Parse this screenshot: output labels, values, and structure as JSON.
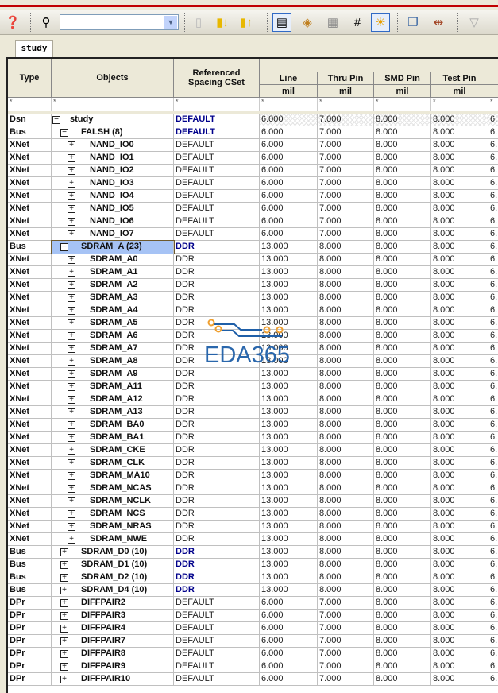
{
  "toolbar": {
    "combo_value": "",
    "buttons": [
      "help-icon",
      "find-icon",
      "bookmark-icon",
      "bookmark-next-icon",
      "bookmark-prev-icon",
      "spacing-icon",
      "net-class-icon",
      "table-icon",
      "same-net-icon",
      "highlight-icon",
      "windows-icon",
      "diff-pair-icon",
      "filter-icon"
    ]
  },
  "tab": {
    "label": "study"
  },
  "columns": {
    "type": "Type",
    "objects": "Objects",
    "cset": "Referenced Spacing CSet",
    "line": "Line",
    "thru": "Thru Pin",
    "smd": "SMD Pin",
    "test": "Test Pin",
    "unit": "mil",
    "filter": "*"
  },
  "rows": [
    {
      "type": "Dsn",
      "obj": "study",
      "exp": "-",
      "lvl": 0,
      "cset": "DEFAULT",
      "v": [
        "6.000",
        "7.000",
        "8.000",
        "8.000",
        "6."
      ]
    },
    {
      "type": "Bus",
      "obj": "FALSH (8)",
      "exp": "-",
      "lvl": 1,
      "cset": "DEFAULT",
      "v": [
        "6.000",
        "7.000",
        "8.000",
        "8.000",
        "6."
      ]
    },
    {
      "type": "XNet",
      "obj": "NAND_IO0",
      "exp": "+",
      "lvl": 2,
      "cset": "DEFAULT",
      "v": [
        "6.000",
        "7.000",
        "8.000",
        "8.000",
        "6."
      ]
    },
    {
      "type": "XNet",
      "obj": "NAND_IO1",
      "exp": "+",
      "lvl": 2,
      "cset": "DEFAULT",
      "v": [
        "6.000",
        "7.000",
        "8.000",
        "8.000",
        "6."
      ]
    },
    {
      "type": "XNet",
      "obj": "NAND_IO2",
      "exp": "+",
      "lvl": 2,
      "cset": "DEFAULT",
      "v": [
        "6.000",
        "7.000",
        "8.000",
        "8.000",
        "6."
      ]
    },
    {
      "type": "XNet",
      "obj": "NAND_IO3",
      "exp": "+",
      "lvl": 2,
      "cset": "DEFAULT",
      "v": [
        "6.000",
        "7.000",
        "8.000",
        "8.000",
        "6."
      ]
    },
    {
      "type": "XNet",
      "obj": "NAND_IO4",
      "exp": "+",
      "lvl": 2,
      "cset": "DEFAULT",
      "v": [
        "6.000",
        "7.000",
        "8.000",
        "8.000",
        "6."
      ]
    },
    {
      "type": "XNet",
      "obj": "NAND_IO5",
      "exp": "+",
      "lvl": 2,
      "cset": "DEFAULT",
      "v": [
        "6.000",
        "7.000",
        "8.000",
        "8.000",
        "6."
      ]
    },
    {
      "type": "XNet",
      "obj": "NAND_IO6",
      "exp": "+",
      "lvl": 2,
      "cset": "DEFAULT",
      "v": [
        "6.000",
        "7.000",
        "8.000",
        "8.000",
        "6."
      ]
    },
    {
      "type": "XNet",
      "obj": "NAND_IO7",
      "exp": "+",
      "lvl": 2,
      "cset": "DEFAULT",
      "v": [
        "6.000",
        "7.000",
        "8.000",
        "8.000",
        "6."
      ]
    },
    {
      "type": "Bus",
      "obj": "SDRAM_A (23)",
      "exp": "-",
      "lvl": 1,
      "cset": "DDR",
      "v": [
        "13.000",
        "8.000",
        "8.000",
        "8.000",
        "6."
      ],
      "selected": true
    },
    {
      "type": "XNet",
      "obj": "SDRAM_A0",
      "exp": "+",
      "lvl": 2,
      "cset": "DDR",
      "v": [
        "13.000",
        "8.000",
        "8.000",
        "8.000",
        "6."
      ]
    },
    {
      "type": "XNet",
      "obj": "SDRAM_A1",
      "exp": "+",
      "lvl": 2,
      "cset": "DDR",
      "v": [
        "13.000",
        "8.000",
        "8.000",
        "8.000",
        "6."
      ]
    },
    {
      "type": "XNet",
      "obj": "SDRAM_A2",
      "exp": "+",
      "lvl": 2,
      "cset": "DDR",
      "v": [
        "13.000",
        "8.000",
        "8.000",
        "8.000",
        "6."
      ]
    },
    {
      "type": "XNet",
      "obj": "SDRAM_A3",
      "exp": "+",
      "lvl": 2,
      "cset": "DDR",
      "v": [
        "13.000",
        "8.000",
        "8.000",
        "8.000",
        "6."
      ]
    },
    {
      "type": "XNet",
      "obj": "SDRAM_A4",
      "exp": "+",
      "lvl": 2,
      "cset": "DDR",
      "v": [
        "13.000",
        "8.000",
        "8.000",
        "8.000",
        "6."
      ]
    },
    {
      "type": "XNet",
      "obj": "SDRAM_A5",
      "exp": "+",
      "lvl": 2,
      "cset": "DDR",
      "v": [
        "13.000",
        "8.000",
        "8.000",
        "8.000",
        "6."
      ]
    },
    {
      "type": "XNet",
      "obj": "SDRAM_A6",
      "exp": "+",
      "lvl": 2,
      "cset": "DDR",
      "v": [
        "13.000",
        "8.000",
        "8.000",
        "8.000",
        "6."
      ]
    },
    {
      "type": "XNet",
      "obj": "SDRAM_A7",
      "exp": "+",
      "lvl": 2,
      "cset": "DDR",
      "v": [
        "13.000",
        "8.000",
        "8.000",
        "8.000",
        "6."
      ]
    },
    {
      "type": "XNet",
      "obj": "SDRAM_A8",
      "exp": "+",
      "lvl": 2,
      "cset": "DDR",
      "v": [
        "13.000",
        "8.000",
        "8.000",
        "8.000",
        "6."
      ]
    },
    {
      "type": "XNet",
      "obj": "SDRAM_A9",
      "exp": "+",
      "lvl": 2,
      "cset": "DDR",
      "v": [
        "13.000",
        "8.000",
        "8.000",
        "8.000",
        "6."
      ]
    },
    {
      "type": "XNet",
      "obj": "SDRAM_A11",
      "exp": "+",
      "lvl": 2,
      "cset": "DDR",
      "v": [
        "13.000",
        "8.000",
        "8.000",
        "8.000",
        "6."
      ]
    },
    {
      "type": "XNet",
      "obj": "SDRAM_A12",
      "exp": "+",
      "lvl": 2,
      "cset": "DDR",
      "v": [
        "13.000",
        "8.000",
        "8.000",
        "8.000",
        "6."
      ]
    },
    {
      "type": "XNet",
      "obj": "SDRAM_A13",
      "exp": "+",
      "lvl": 2,
      "cset": "DDR",
      "v": [
        "13.000",
        "8.000",
        "8.000",
        "8.000",
        "6."
      ]
    },
    {
      "type": "XNet",
      "obj": "SDRAM_BA0",
      "exp": "+",
      "lvl": 2,
      "cset": "DDR",
      "v": [
        "13.000",
        "8.000",
        "8.000",
        "8.000",
        "6."
      ]
    },
    {
      "type": "XNet",
      "obj": "SDRAM_BA1",
      "exp": "+",
      "lvl": 2,
      "cset": "DDR",
      "v": [
        "13.000",
        "8.000",
        "8.000",
        "8.000",
        "6."
      ]
    },
    {
      "type": "XNet",
      "obj": "SDRAM_CKE",
      "exp": "+",
      "lvl": 2,
      "cset": "DDR",
      "v": [
        "13.000",
        "8.000",
        "8.000",
        "8.000",
        "6."
      ]
    },
    {
      "type": "XNet",
      "obj": "SDRAM_CLK",
      "exp": "+",
      "lvl": 2,
      "cset": "DDR",
      "v": [
        "13.000",
        "8.000",
        "8.000",
        "8.000",
        "6."
      ]
    },
    {
      "type": "XNet",
      "obj": "SDRAM_MA10",
      "exp": "+",
      "lvl": 2,
      "cset": "DDR",
      "v": [
        "13.000",
        "8.000",
        "8.000",
        "8.000",
        "6."
      ]
    },
    {
      "type": "XNet",
      "obj": "SDRAM_NCAS",
      "exp": "+",
      "lvl": 2,
      "cset": "DDR",
      "v": [
        "13.000",
        "8.000",
        "8.000",
        "8.000",
        "6."
      ]
    },
    {
      "type": "XNet",
      "obj": "SDRAM_NCLK",
      "exp": "+",
      "lvl": 2,
      "cset": "DDR",
      "v": [
        "13.000",
        "8.000",
        "8.000",
        "8.000",
        "6."
      ]
    },
    {
      "type": "XNet",
      "obj": "SDRAM_NCS",
      "exp": "+",
      "lvl": 2,
      "cset": "DDR",
      "v": [
        "13.000",
        "8.000",
        "8.000",
        "8.000",
        "6."
      ]
    },
    {
      "type": "XNet",
      "obj": "SDRAM_NRAS",
      "exp": "+",
      "lvl": 2,
      "cset": "DDR",
      "v": [
        "13.000",
        "8.000",
        "8.000",
        "8.000",
        "6."
      ]
    },
    {
      "type": "XNet",
      "obj": "SDRAM_NWE",
      "exp": "+",
      "lvl": 2,
      "cset": "DDR",
      "v": [
        "13.000",
        "8.000",
        "8.000",
        "8.000",
        "6."
      ]
    },
    {
      "type": "Bus",
      "obj": "SDRAM_D0 (10)",
      "exp": "+",
      "lvl": 1,
      "cset": "DDR",
      "v": [
        "13.000",
        "8.000",
        "8.000",
        "8.000",
        "6."
      ]
    },
    {
      "type": "Bus",
      "obj": "SDRAM_D1 (10)",
      "exp": "+",
      "lvl": 1,
      "cset": "DDR",
      "v": [
        "13.000",
        "8.000",
        "8.000",
        "8.000",
        "6."
      ]
    },
    {
      "type": "Bus",
      "obj": "SDRAM_D2 (10)",
      "exp": "+",
      "lvl": 1,
      "cset": "DDR",
      "v": [
        "13.000",
        "8.000",
        "8.000",
        "8.000",
        "6."
      ]
    },
    {
      "type": "Bus",
      "obj": "SDRAM_D4 (10)",
      "exp": "+",
      "lvl": 1,
      "cset": "DDR",
      "v": [
        "13.000",
        "8.000",
        "8.000",
        "8.000",
        "6."
      ]
    },
    {
      "type": "DPr",
      "obj": "DIFFPAIR2",
      "exp": "+",
      "lvl": 1,
      "cset": "DEFAULT",
      "v": [
        "6.000",
        "7.000",
        "8.000",
        "8.000",
        "6."
      ]
    },
    {
      "type": "DPr",
      "obj": "DIFFPAIR3",
      "exp": "+",
      "lvl": 1,
      "cset": "DEFAULT",
      "v": [
        "6.000",
        "7.000",
        "8.000",
        "8.000",
        "6."
      ]
    },
    {
      "type": "DPr",
      "obj": "DIFFPAIR4",
      "exp": "+",
      "lvl": 1,
      "cset": "DEFAULT",
      "v": [
        "6.000",
        "7.000",
        "8.000",
        "8.000",
        "6."
      ]
    },
    {
      "type": "DPr",
      "obj": "DIFFPAIR7",
      "exp": "+",
      "lvl": 1,
      "cset": "DEFAULT",
      "v": [
        "6.000",
        "7.000",
        "8.000",
        "8.000",
        "6."
      ]
    },
    {
      "type": "DPr",
      "obj": "DIFFPAIR8",
      "exp": "+",
      "lvl": 1,
      "cset": "DEFAULT",
      "v": [
        "6.000",
        "7.000",
        "8.000",
        "8.000",
        "6."
      ]
    },
    {
      "type": "DPr",
      "obj": "DIFFPAIR9",
      "exp": "+",
      "lvl": 1,
      "cset": "DEFAULT",
      "v": [
        "6.000",
        "7.000",
        "8.000",
        "8.000",
        "6."
      ]
    },
    {
      "type": "DPr",
      "obj": "DIFFPAIR10",
      "exp": "+",
      "lvl": 1,
      "cset": "DEFAULT",
      "v": [
        "6.000",
        "7.000",
        "8.000",
        "8.000",
        "6."
      ]
    }
  ],
  "watermark": {
    "text": "EDA365",
    "color": "#1f5fa8",
    "accent": "#f0a030"
  }
}
